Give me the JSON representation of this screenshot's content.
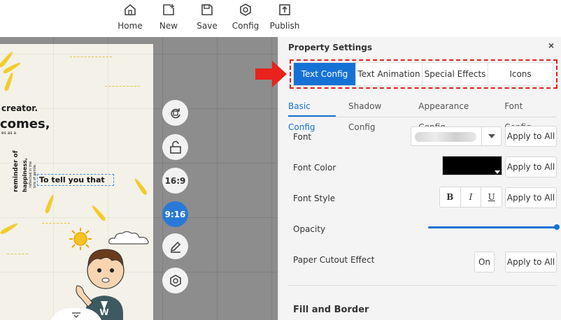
{
  "toolbar": {
    "items": [
      {
        "label": "Home",
        "icon": "home-icon"
      },
      {
        "label": "New",
        "icon": "new-page-icon"
      },
      {
        "label": "Save",
        "icon": "save-icon"
      },
      {
        "label": "Config",
        "icon": "config-icon"
      },
      {
        "label": "Publish",
        "icon": "publish-icon"
      }
    ]
  },
  "canvas": {
    "page_text": {
      "creator": "creator.",
      "comes": "comes,",
      "small_line": "es as a",
      "reminder": "reminder of",
      "happiness": "happiness,",
      "tiny_1": "reflected in the",
      "tiny_2": "bits of gentle.",
      "selected": "To tell you that"
    },
    "tools": {
      "rotate_icon": "rotate-icon",
      "unlock_icon": "unlock-icon",
      "ratio_169": "16:9",
      "ratio_916": "9:16",
      "edit_icon": "pencil-icon",
      "settings_icon": "settings-icon"
    }
  },
  "panel": {
    "title": "Property Settings",
    "close": "×",
    "main_tabs": [
      "Text Config",
      "Text Animation",
      "Special Effects",
      "Icons"
    ],
    "active_main_tab": "Text Config",
    "sub_tabs": [
      "Basic Config",
      "Shadow Config",
      "Appearance Config",
      "Font Config"
    ],
    "active_sub_tab": "Basic Config",
    "rows": {
      "font": "Font",
      "font_color": "Font Color",
      "font_style": "Font Style",
      "opacity": "Opacity",
      "paper_cutout": "Paper Cutout Effect"
    },
    "apply_label": "Apply to All",
    "style_buttons": [
      "B",
      "I",
      "U"
    ],
    "cutout_value": "On",
    "opacity_value": 1.0,
    "font_color_value": "#000000",
    "section_fill_border": "Fill and Border"
  },
  "colors": {
    "accent": "#1572d4",
    "highlight_border": "#d9231f",
    "arrow": "#e8221c"
  }
}
